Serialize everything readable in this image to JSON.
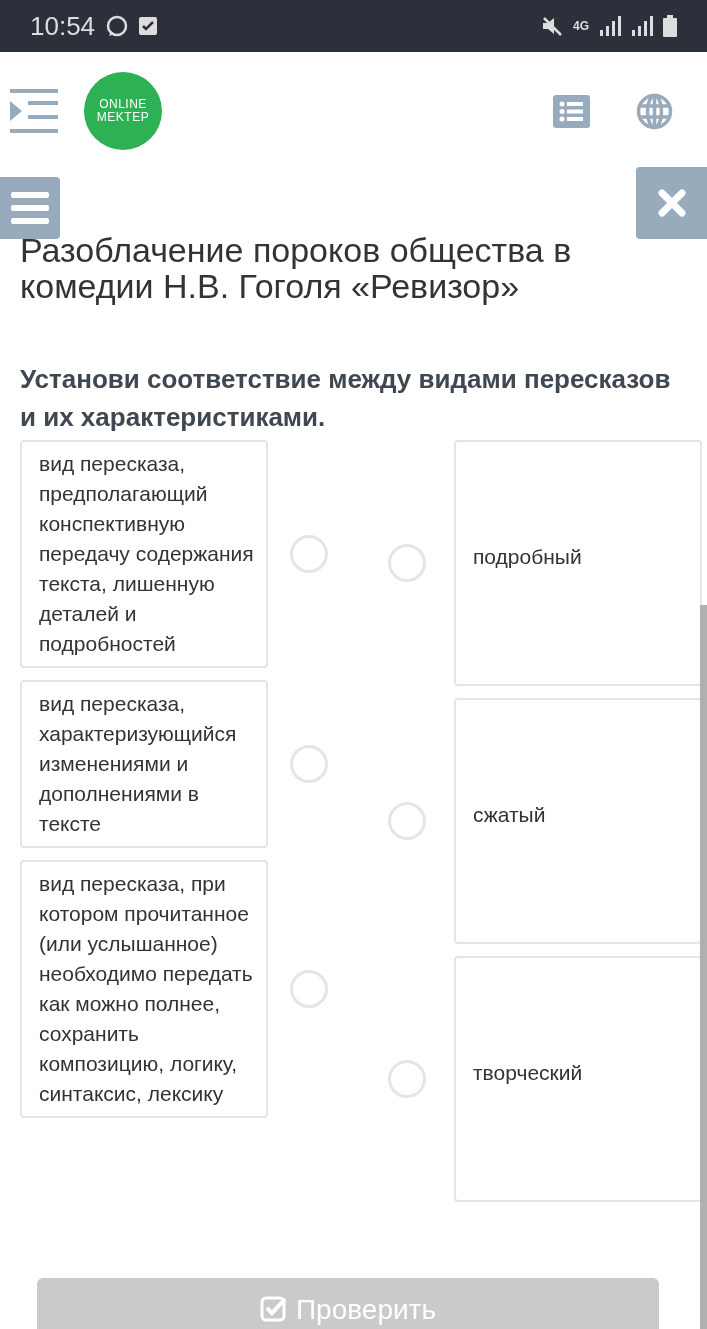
{
  "status_bar": {
    "time": "10:54",
    "network": "4G"
  },
  "header": {
    "logo_line_1": "ONLINE",
    "logo_line_2": "MEKTEP"
  },
  "title": "Разоблачение пороков общества в комедии Н.В. Гоголя «Ревизор»",
  "question": "Установи соответствие между видами пересказов и их характеристиками.",
  "left_items": [
    {
      "text": "вид пересказа, предполагающий конспективную передачу содержания текста, лишенную деталей и подробностей",
      "selected": false
    },
    {
      "text": "вид пересказа, характеризующийся изменениями и дополнениями в тексте",
      "selected": false
    },
    {
      "text": "вид пересказа, при котором прочитанное (или услышанное) необходимо передать как можно полнее, сохранить композицию, логику, синтаксис, лексику",
      "selected": false
    }
  ],
  "right_items": [
    {
      "text": "подробный",
      "selected": false
    },
    {
      "text": "сжатый",
      "selected": false
    },
    {
      "text": "творческий",
      "selected": false
    }
  ],
  "check_button": {
    "label": "Проверить",
    "disabled": true
  }
}
